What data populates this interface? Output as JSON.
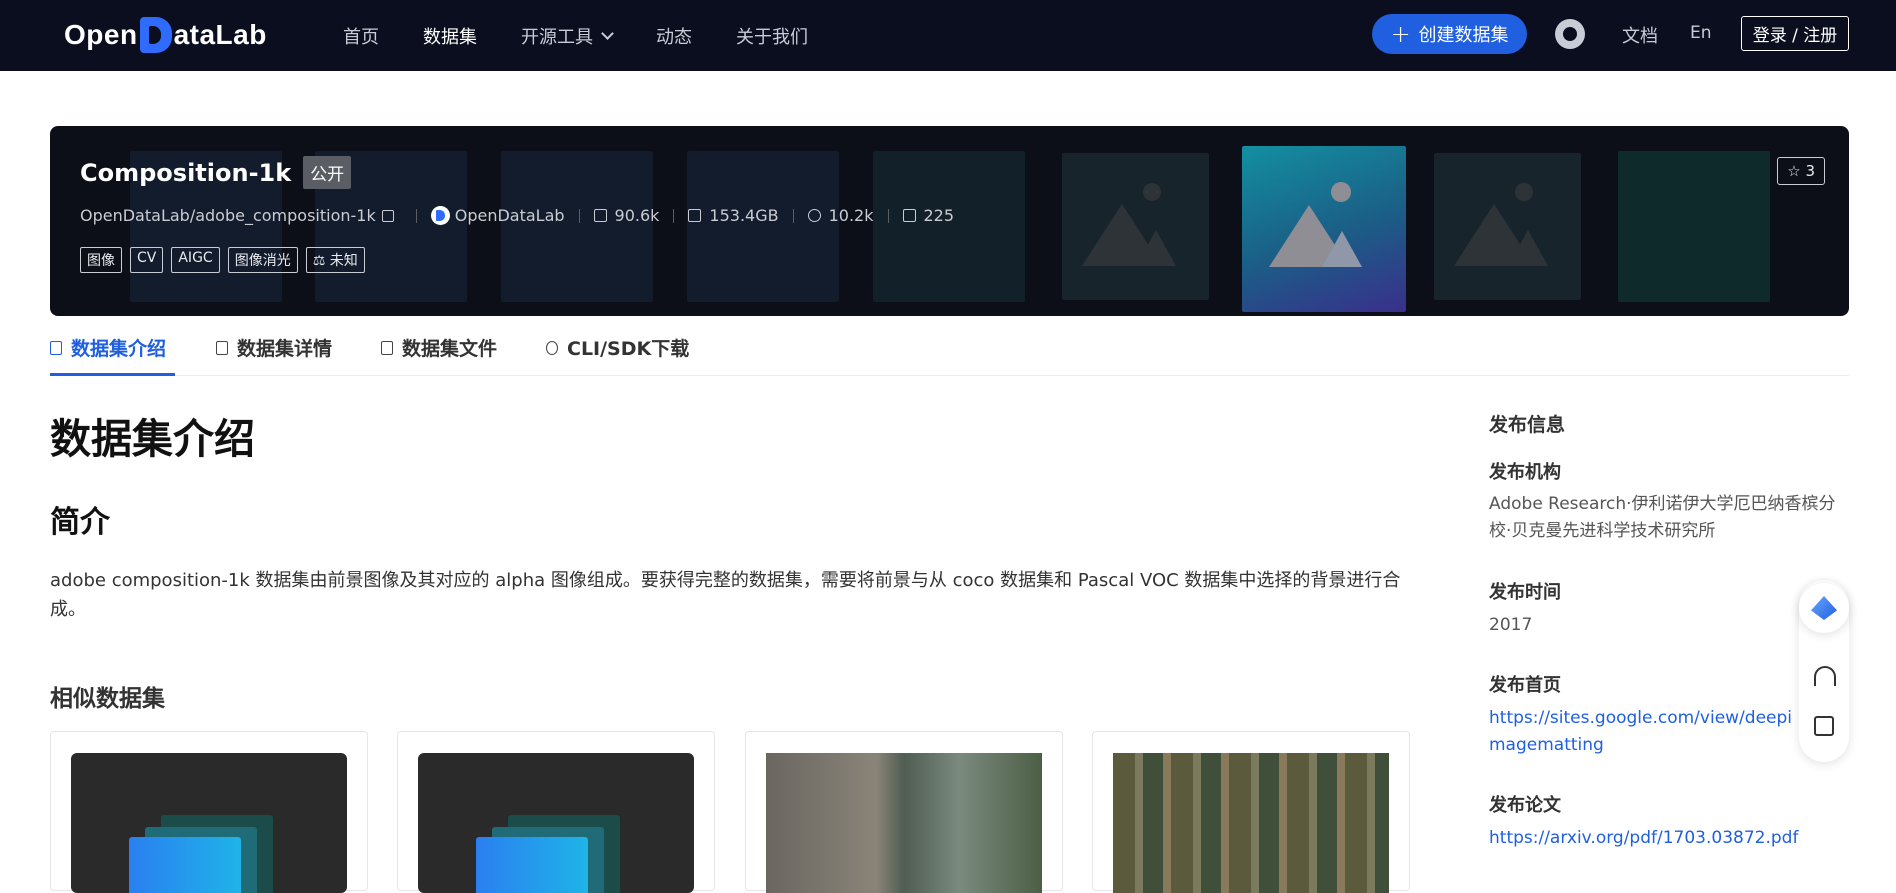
{
  "nav": {
    "logo": "OpenDataLab",
    "items": [
      "首页",
      "数据集",
      "开源工具",
      "动态",
      "关于我们"
    ],
    "create_button": "创建数据集",
    "docs": "文档",
    "lang": "En",
    "login": "登录 / 注册"
  },
  "hero": {
    "title": "Composition-1k",
    "visibility": "公开",
    "repo": "OpenDataLab/adobe_composition-1k",
    "org": "OpenDataLab",
    "files": "90.6k",
    "size": "153.4GB",
    "views": "10.2k",
    "downloads": "225",
    "tags": [
      "图像",
      "CV",
      "AIGC",
      "图像消光",
      "未知"
    ],
    "stars": "3"
  },
  "tabs": [
    "数据集介绍",
    "数据集详情",
    "数据集文件",
    "CLI/SDK下载"
  ],
  "intro": {
    "heading": "数据集介绍",
    "subheading": "简介",
    "text": "adobe composition-1k 数据集由前景图像及其对应的 alpha 图像组成。要获得完整的数据集，需要将前景与从 coco 数据集和 Pascal VOC 数据集中选择的背景进行合成。",
    "similar_heading": "相似数据集"
  },
  "side": {
    "heading": "发布信息",
    "org_label": "发布机构",
    "org_value": "Adobe Research·伊利诺伊大学厄巴纳香槟分校·贝克曼先进科学技术研究所",
    "date_label": "发布时间",
    "date_value": "2017",
    "homepage_label": "发布首页",
    "homepage_value": "https://sites.google.com/view/deepimagematting",
    "paper_label": "发布论文",
    "paper_value": "https://arxiv.org/pdf/1703.03872.pdf"
  },
  "colors": {
    "brand": "#1f5fe0",
    "nav_bg": "#0a0e1f",
    "hero_bg": "#0c0f17"
  }
}
